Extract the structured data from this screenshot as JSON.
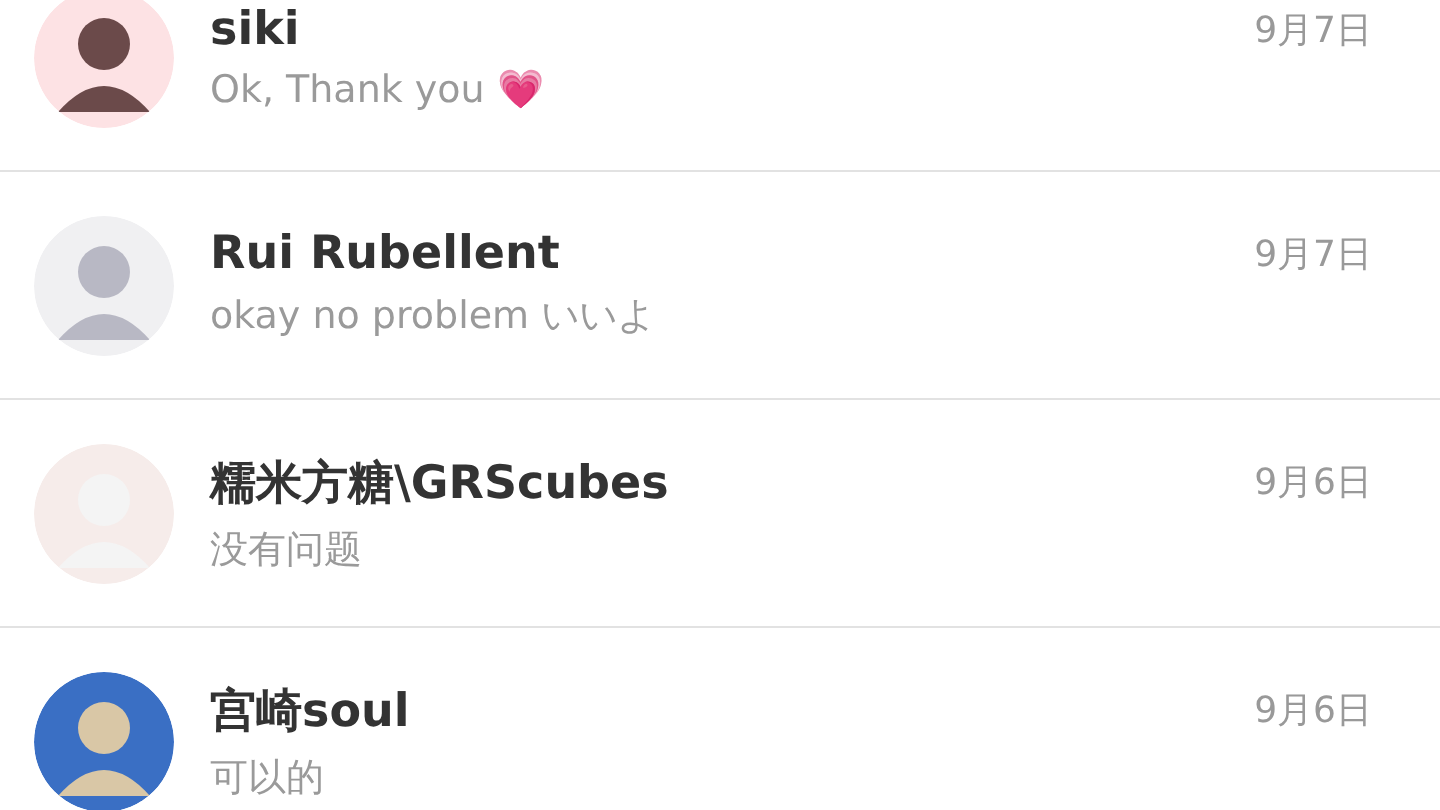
{
  "chats": [
    {
      "name": "siki",
      "message": "Ok, Thank you 💗",
      "date": "9月7日"
    },
    {
      "name": "Rui Rubellent",
      "message": "okay no problem いいよ",
      "date": "9月7日"
    },
    {
      "name": "糯米方糖\\GRScubes",
      "message": "没有问题",
      "date": "9月6日"
    },
    {
      "name": "宫崎soul",
      "message": "可以的",
      "date": "9月6日"
    }
  ]
}
